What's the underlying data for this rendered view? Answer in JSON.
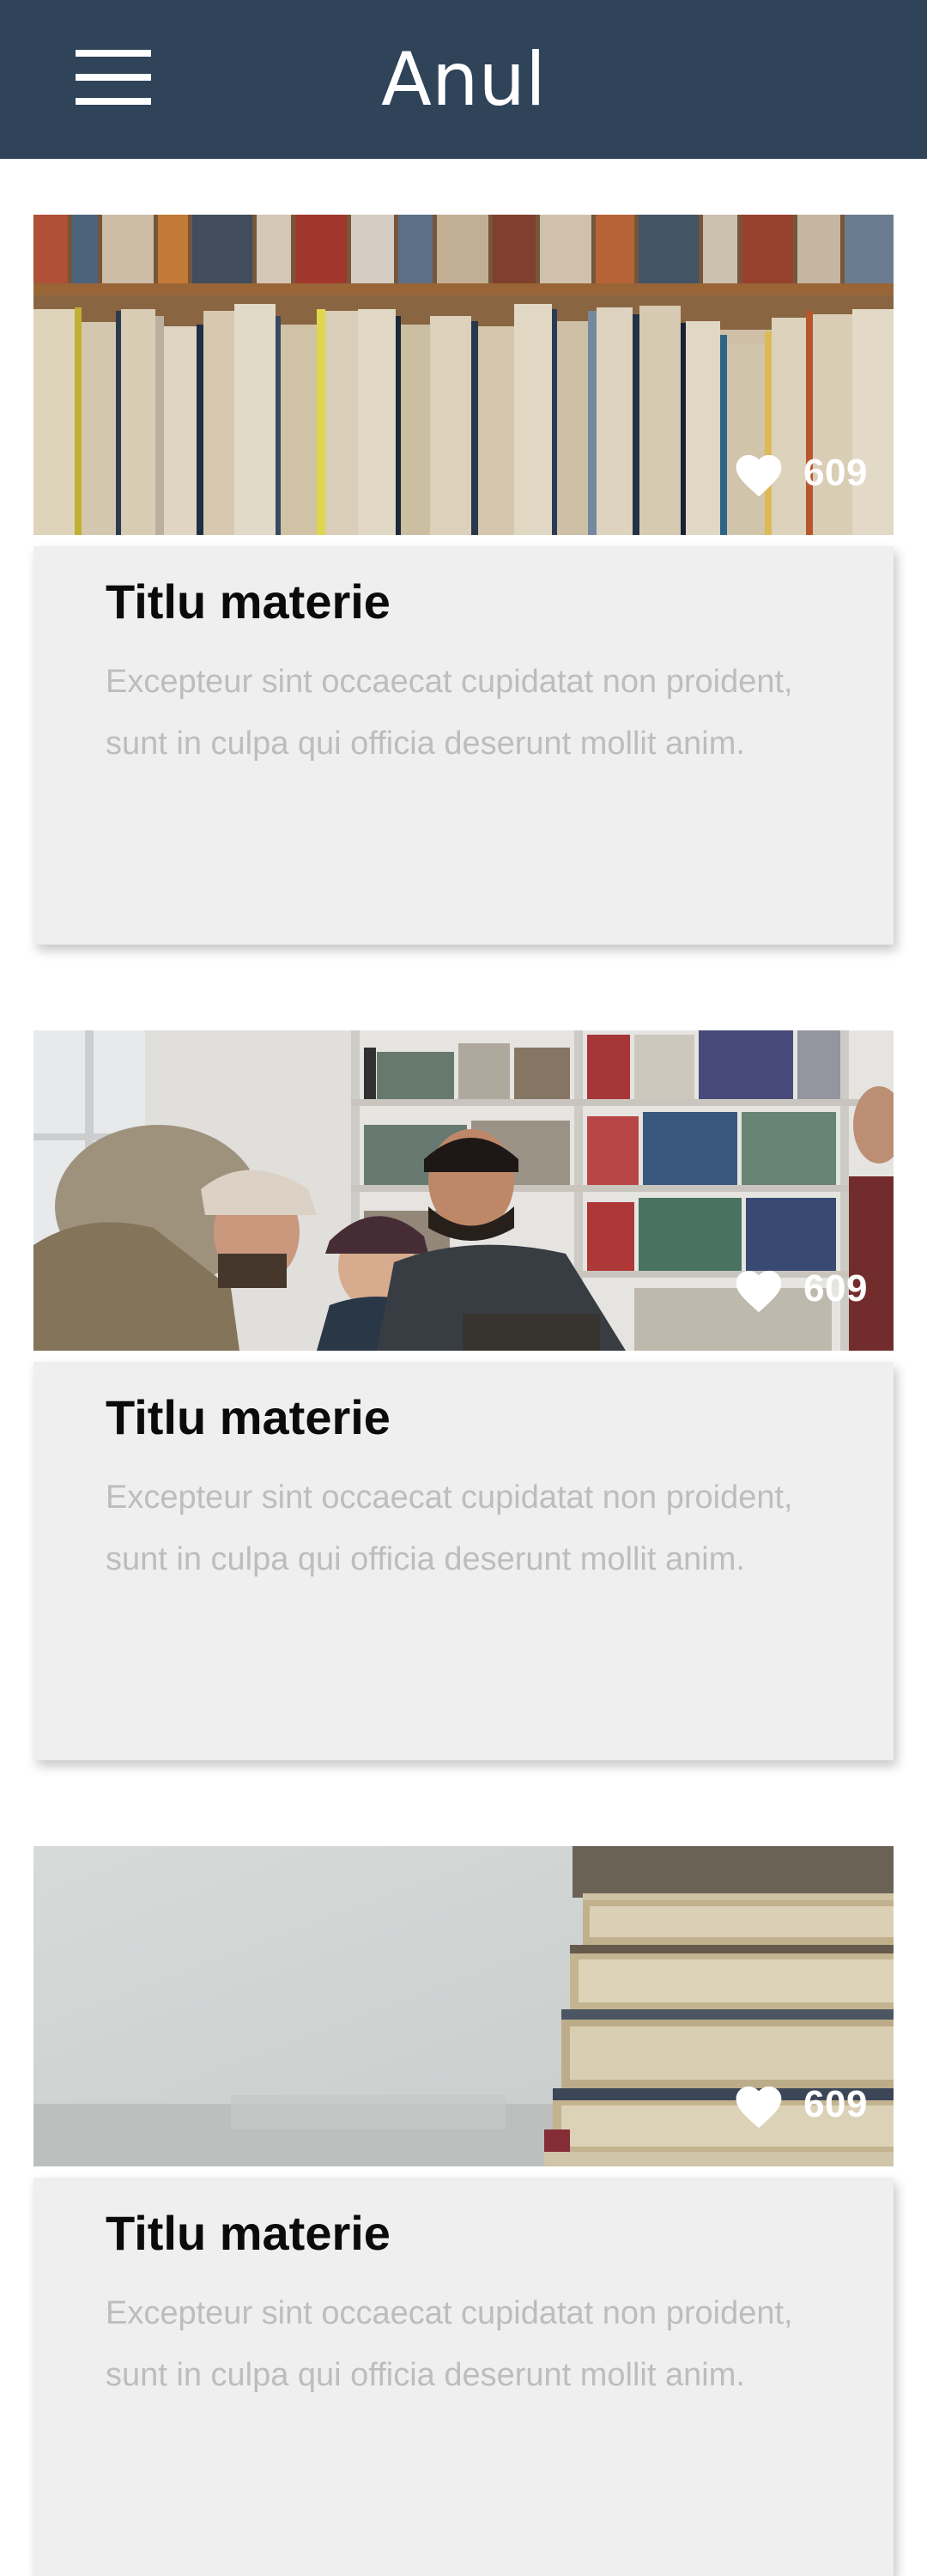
{
  "header": {
    "title": "Anul",
    "menu_icon": "hamburger-menu-icon",
    "background": "#2f4359"
  },
  "cards": [
    {
      "image": "bookshelf-photo",
      "like_icon": "heart-icon",
      "likes": "609",
      "title": "Titlu materie",
      "description": "Excepteur sint occaecat cupidatat non proident, sunt in culpa qui officia deserunt mollit anim."
    },
    {
      "image": "students-laughing-photo",
      "like_icon": "heart-icon",
      "likes": "609",
      "title": "Titlu materie",
      "description": "Excepteur sint occaecat cupidatat non proident, sunt in culpa qui officia deserunt mollit anim."
    },
    {
      "image": "stacked-books-photo",
      "like_icon": "heart-icon",
      "likes": "609",
      "title": "Titlu materie",
      "description": "Excepteur sint occaecat cupidatat non proident, sunt in culpa qui officia deserunt mollit anim."
    }
  ]
}
